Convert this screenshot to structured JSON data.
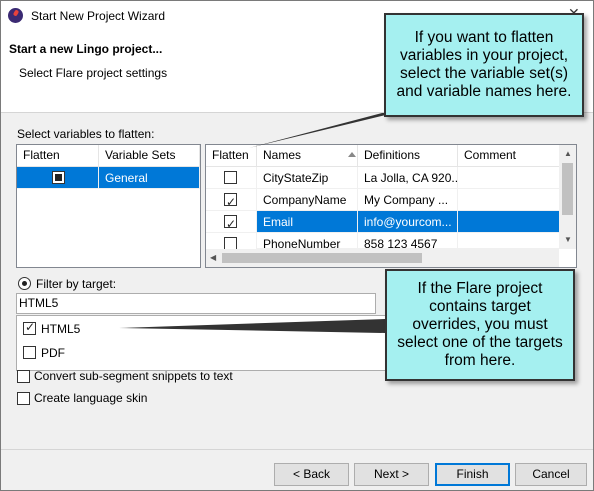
{
  "window": {
    "title": "Start New Project Wizard",
    "minimize_glyph": "–",
    "close_glyph": "✕"
  },
  "header": {
    "title": "Start a new Lingo project...",
    "subtitle": "Select Flare project settings"
  },
  "variables": {
    "label": "Select variables to flatten:",
    "sets_grid": {
      "columns": [
        "Flatten",
        "Variable Sets"
      ],
      "rows": [
        {
          "flatten": "partial",
          "name": "General",
          "selected": true
        }
      ]
    },
    "names_grid": {
      "columns": [
        "Flatten",
        "Names",
        "Definitions",
        "Comment"
      ],
      "rows": [
        {
          "flatten": false,
          "name": "CityStateZip",
          "definition": "La Jolla, CA 920...",
          "comment": "",
          "selected": false
        },
        {
          "flatten": true,
          "name": "CompanyName",
          "definition": "My Company ...",
          "comment": "",
          "selected": false
        },
        {
          "flatten": true,
          "name": "Email",
          "definition": "info@yourcom...",
          "comment": "",
          "selected": true
        },
        {
          "flatten": false,
          "name": "PhoneNumber",
          "definition": "858 123 4567",
          "comment": "",
          "selected": false
        }
      ]
    }
  },
  "filter": {
    "radio_label": "Filter by target:",
    "input_value": "HTML5",
    "targets": [
      {
        "label": "HTML5",
        "checked": true
      },
      {
        "label": "PDF",
        "checked": false
      }
    ]
  },
  "options": {
    "convert_label": "Convert sub-segment snippets to text",
    "skin_label": "Create language skin"
  },
  "buttons": {
    "back": "< Back",
    "next": "Next >",
    "finish": "Finish",
    "cancel": "Cancel"
  },
  "callouts": {
    "variables": "If you want to flatten variables in your project, select the variable set(s) and variable names here.",
    "targets": "If the Flare project contains target overrides, you must select one of the targets from here."
  },
  "colors": {
    "selection": "#0078d7",
    "callout_fill": "#a5f0f0"
  }
}
